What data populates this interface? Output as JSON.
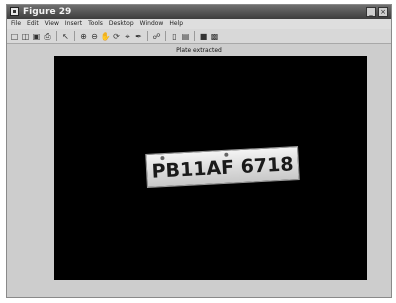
{
  "window": {
    "title": "Figure 29",
    "minimize_glyph": "_",
    "close_glyph": "×"
  },
  "menu": {
    "items": [
      "File",
      "Edit",
      "View",
      "Insert",
      "Tools",
      "Desktop",
      "Window",
      "Help"
    ]
  },
  "toolbar": {
    "icons": [
      "new-figure-icon",
      "open-icon",
      "save-icon",
      "print-icon",
      "select-arrow-icon",
      "zoom-in-icon",
      "zoom-out-icon",
      "pan-icon",
      "rotate-3d-icon",
      "data-cursor-icon",
      "brush-icon",
      "link-icon",
      "insert-colorbar-icon",
      "insert-legend-icon",
      "hide-plot-tools-icon",
      "show-plot-tools-icon"
    ]
  },
  "figure": {
    "title": "Plate extracted",
    "plate_text": "PB11AF 6718"
  }
}
